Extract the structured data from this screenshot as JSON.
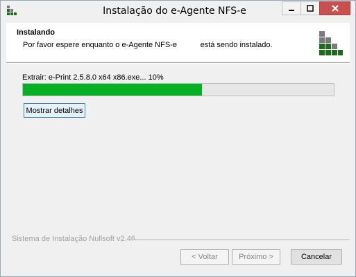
{
  "window": {
    "title": "Instalação do e-Agente NFS-e",
    "controls": {
      "minimize": "—",
      "maximize": "□",
      "close": "✕"
    }
  },
  "header": {
    "title": "Instalando",
    "subtitle": "Por favor espere enquanto o e-Agente NFS-e           está sendo instalado."
  },
  "progress": {
    "status": "Extrair: e-Print 2.5.8.0 x64 x86.exe... 10%",
    "fraction": 0.575,
    "color": "#06b025"
  },
  "details_button": {
    "label": "Mostrar detalhes"
  },
  "footer": {
    "branding": "Sistema de Instalação Nullsoft v2.46",
    "back_label": "< Voltar",
    "next_label": "Próximo >",
    "cancel_label": "Cancelar"
  },
  "logo": {
    "dark": "#1f4e1f",
    "light": "#8a8a8a",
    "green": "#1e6b1e"
  }
}
